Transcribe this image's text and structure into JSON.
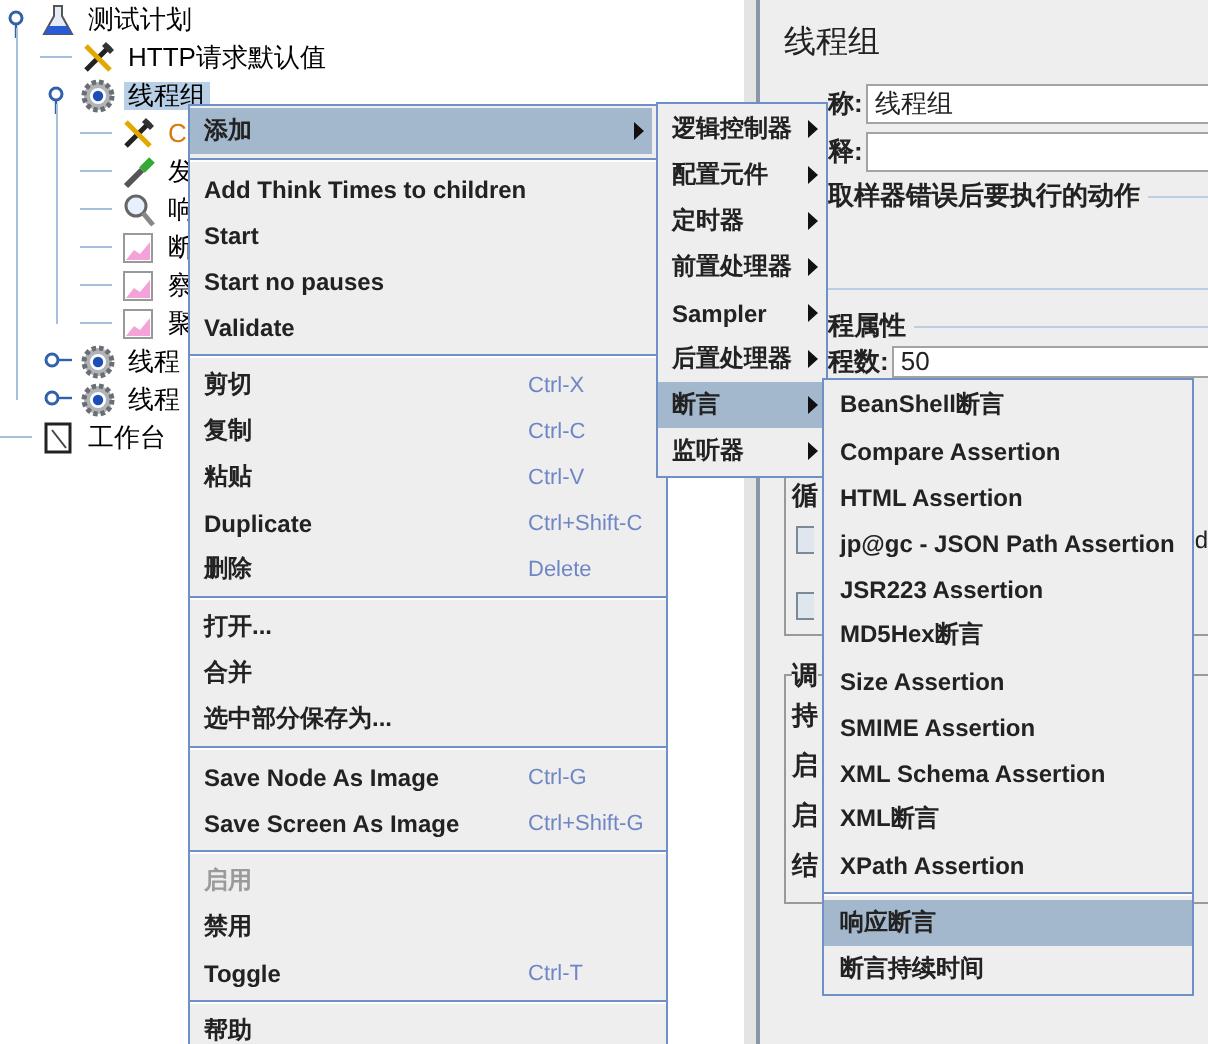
{
  "tree": [
    {
      "label": "测试计划",
      "kind": "plan",
      "expanded": true,
      "selected": false,
      "children": [
        {
          "label": "HTTP请求默认值",
          "kind": "config",
          "selected": false
        },
        {
          "label": "线程组",
          "kind": "thread_group",
          "expanded": true,
          "selected": true,
          "children": [
            {
              "label": "C",
              "kind": "config",
              "selected": false,
              "color": "#d97a10"
            },
            {
              "label": "发",
              "kind": "sampler",
              "selected": false
            },
            {
              "label": "响",
              "kind": "viewer",
              "selected": false
            },
            {
              "label": "断",
              "kind": "listener",
              "selected": false
            },
            {
              "label": "察",
              "kind": "listener",
              "selected": false
            },
            {
              "label": "聚",
              "kind": "listener",
              "selected": false
            }
          ]
        },
        {
          "label": "线程",
          "kind": "thread_group",
          "expanded": false,
          "selected": false
        },
        {
          "label": "线程",
          "kind": "thread_group",
          "expanded": false,
          "selected": false
        }
      ]
    },
    {
      "label": "工作台",
      "kind": "workbench",
      "selected": false
    }
  ],
  "detail": {
    "title": "线程组",
    "name_field": {
      "label": "称:",
      "value": "线程组"
    },
    "comment_field": {
      "label": "释:"
    },
    "error_section": {
      "title": "取样器错误后要执行的动作"
    },
    "thread_section": {
      "title": "程属性",
      "threads": {
        "label": "程数:",
        "value": "50"
      },
      "loop_label": "循",
      "checkboxes": [
        {
          "checked": false,
          "trailing": "d"
        },
        {
          "checked": false
        }
      ]
    },
    "scheduler": {
      "title": "调",
      "labels": [
        "持",
        "启",
        "启",
        "结"
      ]
    }
  },
  "context_menu": {
    "items": [
      {
        "kind": "item",
        "label": "添加",
        "submenu": true,
        "selected": true,
        "disabled": false
      },
      {
        "kind": "separator"
      },
      {
        "kind": "item",
        "label": "Add Think Times to children",
        "selected": false,
        "disabled": false
      },
      {
        "kind": "item",
        "label": "Start",
        "selected": false,
        "disabled": false
      },
      {
        "kind": "item",
        "label": "Start no pauses",
        "selected": false,
        "disabled": false
      },
      {
        "kind": "item",
        "label": "Validate",
        "selected": false,
        "disabled": false
      },
      {
        "kind": "separator"
      },
      {
        "kind": "item",
        "label": "剪切",
        "shortcut": "Ctrl-X",
        "selected": false,
        "disabled": false
      },
      {
        "kind": "item",
        "label": "复制",
        "shortcut": "Ctrl-C",
        "selected": false,
        "disabled": false
      },
      {
        "kind": "item",
        "label": "粘贴",
        "shortcut": "Ctrl-V",
        "selected": false,
        "disabled": false
      },
      {
        "kind": "item",
        "label": "Duplicate",
        "shortcut": "Ctrl+Shift-C",
        "selected": false,
        "disabled": false
      },
      {
        "kind": "item",
        "label": "删除",
        "shortcut": "Delete",
        "selected": false,
        "disabled": false
      },
      {
        "kind": "separator"
      },
      {
        "kind": "item",
        "label": "打开...",
        "selected": false,
        "disabled": false
      },
      {
        "kind": "item",
        "label": "合并",
        "selected": false,
        "disabled": false
      },
      {
        "kind": "item",
        "label": "选中部分保存为...",
        "selected": false,
        "disabled": false
      },
      {
        "kind": "separator"
      },
      {
        "kind": "item",
        "label": "Save Node As Image",
        "shortcut": "Ctrl-G",
        "selected": false,
        "disabled": false
      },
      {
        "kind": "item",
        "label": "Save Screen As Image",
        "shortcut": "Ctrl+Shift-G",
        "selected": false,
        "disabled": false
      },
      {
        "kind": "separator"
      },
      {
        "kind": "item",
        "label": "启用",
        "selected": false,
        "disabled": true
      },
      {
        "kind": "item",
        "label": "禁用",
        "selected": false,
        "disabled": false
      },
      {
        "kind": "item",
        "label": "Toggle",
        "shortcut": "Ctrl-T",
        "selected": false,
        "disabled": false
      },
      {
        "kind": "separator"
      },
      {
        "kind": "item",
        "label": "帮助",
        "selected": false,
        "disabled": false
      }
    ]
  },
  "add_submenu": {
    "items": [
      {
        "kind": "item",
        "label": "逻辑控制器",
        "submenu": true,
        "selected": false
      },
      {
        "kind": "item",
        "label": "配置元件",
        "submenu": true,
        "selected": false
      },
      {
        "kind": "item",
        "label": "定时器",
        "submenu": true,
        "selected": false
      },
      {
        "kind": "item",
        "label": "前置处理器",
        "submenu": true,
        "selected": false
      },
      {
        "kind": "item",
        "label": "Sampler",
        "submenu": true,
        "selected": false
      },
      {
        "kind": "item",
        "label": "后置处理器",
        "submenu": true,
        "selected": false
      },
      {
        "kind": "item",
        "label": "断言",
        "submenu": true,
        "selected": true
      },
      {
        "kind": "item",
        "label": "监听器",
        "submenu": true,
        "selected": false
      }
    ]
  },
  "assertion_submenu": {
    "items": [
      {
        "kind": "item",
        "label": "BeanShell断言",
        "selected": false
      },
      {
        "kind": "item",
        "label": "Compare Assertion",
        "selected": false
      },
      {
        "kind": "item",
        "label": "HTML Assertion",
        "selected": false
      },
      {
        "kind": "item",
        "label": "jp@gc - JSON Path Assertion",
        "selected": false
      },
      {
        "kind": "item",
        "label": "JSR223 Assertion",
        "selected": false
      },
      {
        "kind": "item",
        "label": "MD5Hex断言",
        "selected": false
      },
      {
        "kind": "item",
        "label": "Size Assertion",
        "selected": false
      },
      {
        "kind": "item",
        "label": "SMIME Assertion",
        "selected": false
      },
      {
        "kind": "item",
        "label": "XML Schema Assertion",
        "selected": false
      },
      {
        "kind": "item",
        "label": "XML断言",
        "selected": false
      },
      {
        "kind": "item",
        "label": "XPath Assertion",
        "selected": false
      },
      {
        "kind": "separator"
      },
      {
        "kind": "item",
        "label": "响应断言",
        "selected": true
      },
      {
        "kind": "item",
        "label": "断言持续时间",
        "selected": false
      }
    ]
  }
}
